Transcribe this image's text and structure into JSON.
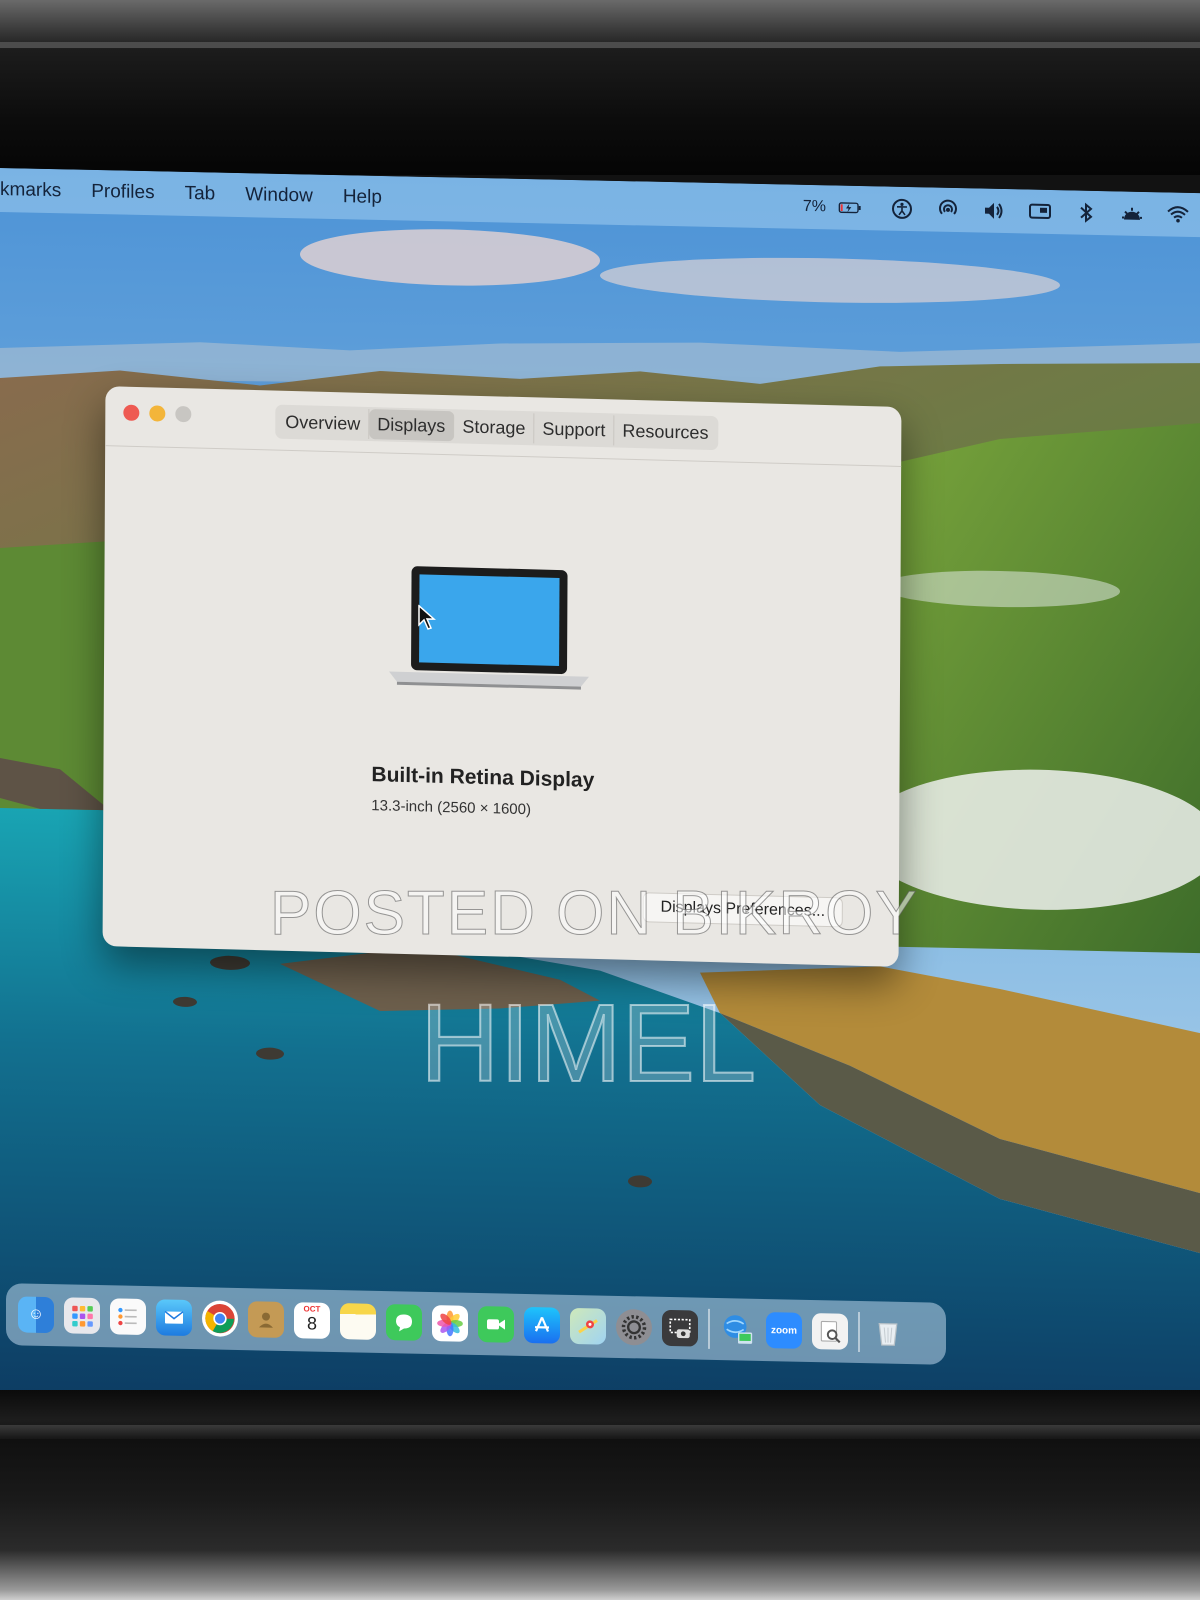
{
  "menubar": {
    "items": [
      "kmarks",
      "Profiles",
      "Tab",
      "Window",
      "Help"
    ],
    "battery_percent": "7%",
    "status_icons": [
      "battery-charging-icon",
      "accessibility-icon",
      "airdrop-icon",
      "volume-icon",
      "display-icon",
      "bluetooth-icon",
      "brightness-icon",
      "wifi-icon"
    ]
  },
  "window": {
    "tabs": [
      {
        "label": "Overview",
        "active": false
      },
      {
        "label": "Displays",
        "active": true
      },
      {
        "label": "Storage",
        "active": false
      },
      {
        "label": "Support",
        "active": false
      },
      {
        "label": "Resources",
        "active": false
      }
    ],
    "display_name": "Built-in Retina Display",
    "display_spec": "13.3-inch (2560 × 1600)",
    "preferences_button": "Displays Preferences..."
  },
  "dock": {
    "icons": [
      "finder-icon",
      "launchpad-icon",
      "reminders-icon",
      "mail-icon",
      "chrome-icon",
      "contacts-icon",
      "calendar-icon",
      "notes-icon",
      "messages-icon",
      "photos-icon",
      "facetime-icon",
      "app-store-icon",
      "maps-icon",
      "system-preferences-icon",
      "screenshot-icon",
      "network-app-icon",
      "zoom-icon",
      "preview-icon",
      "trash-icon"
    ],
    "calendar_month": "OCT",
    "calendar_day": "8",
    "zoom_label": "zoom"
  },
  "watermark": {
    "line1": "POSTED ON BIKROY",
    "line2": "HIMEL"
  },
  "colors": {
    "close": "#ee5a52",
    "minimize": "#f3b53a",
    "maximize": "#c8c6c2",
    "window_bg": "#e9e7e3"
  }
}
